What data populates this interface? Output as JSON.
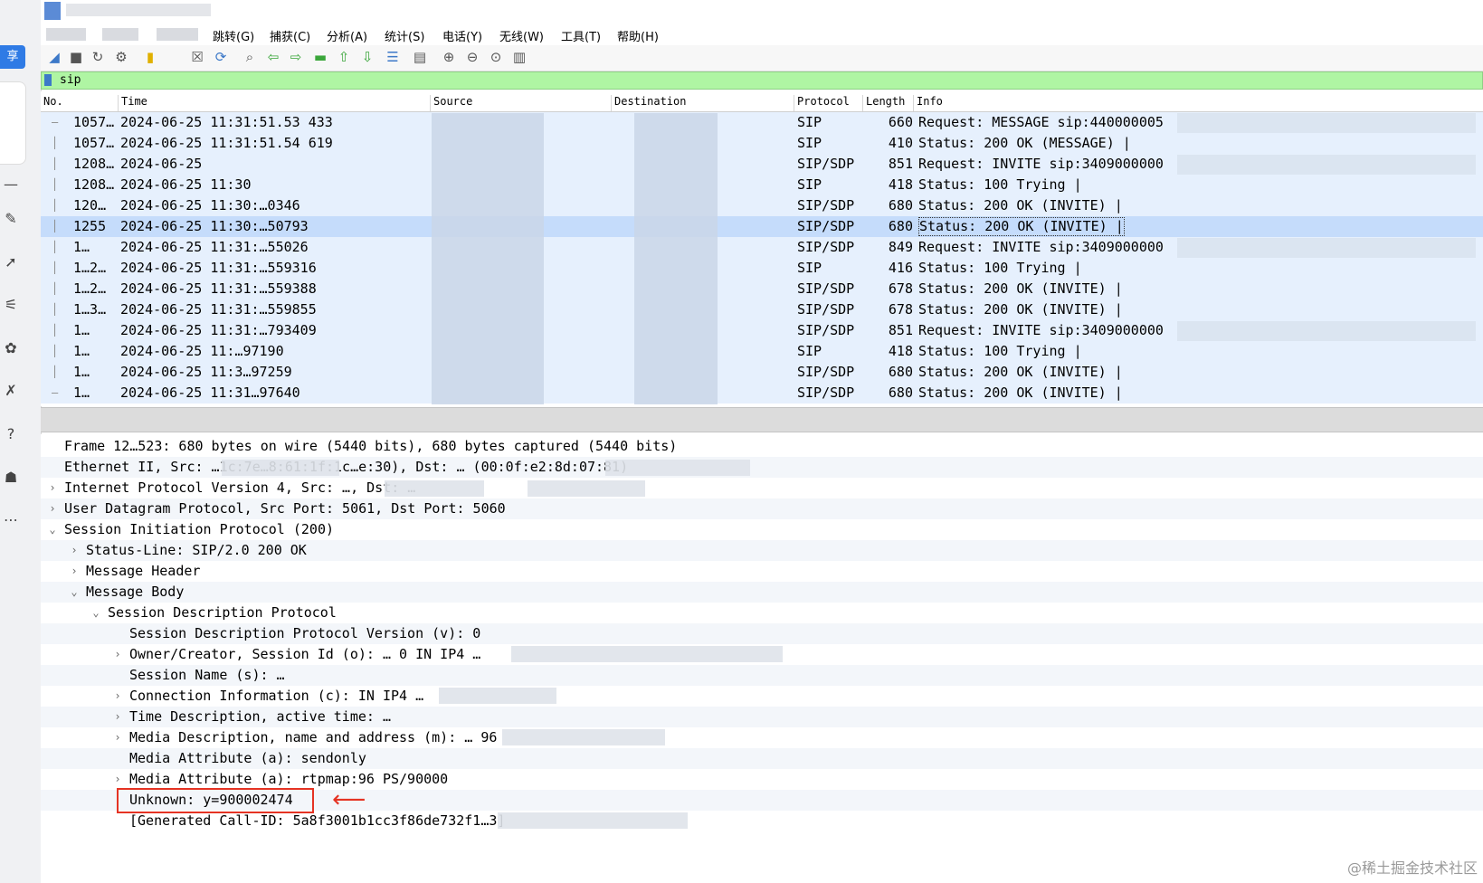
{
  "menubar": {
    "items": [
      "跳转(G)",
      "捕获(C)",
      "分析(A)",
      "统计(S)",
      "电话(Y)",
      "无线(W)",
      "工具(T)",
      "帮助(H)"
    ]
  },
  "sidebar": {
    "share_label": "享"
  },
  "filter": {
    "value": "sip"
  },
  "packet_list": {
    "headers": [
      "No.",
      "Time",
      "Source",
      "Destination",
      "Protocol",
      "Length",
      "Info"
    ],
    "rows": [
      {
        "no": "1057…",
        "time": "2024-06-25 11:31:51.53 433",
        "protocol": "SIP",
        "length": "660",
        "info": "Request: MESSAGE sip:440000005"
      },
      {
        "no": "1057…",
        "time": "2024-06-25 11:31:51.54 619",
        "protocol": "SIP",
        "length": "410",
        "info": "Status: 200 OK (MESSAGE) |"
      },
      {
        "no": "1208…",
        "time": "2024-06-25",
        "protocol": "SIP/SDP",
        "length": "851",
        "info": "Request: INVITE sip:3409000000"
      },
      {
        "no": "1208…",
        "time": "2024-06-25 11:30",
        "protocol": "SIP",
        "length": "418",
        "info": "Status: 100 Trying |"
      },
      {
        "no": "120…",
        "time": "2024-06-25 11:30:…0346",
        "protocol": "SIP/SDP",
        "length": "680",
        "info": "Status: 200 OK (INVITE) |"
      },
      {
        "no": "1255",
        "time": "2024-06-25 11:30:…50793",
        "protocol": "SIP/SDP",
        "length": "680",
        "info": "Status: 200 OK (INVITE) |",
        "selected": true
      },
      {
        "no": "1…",
        "time": "2024-06-25 11:31:…55026",
        "protocol": "SIP/SDP",
        "length": "849",
        "info": "Request: INVITE sip:3409000000"
      },
      {
        "no": "1…2…",
        "time": "2024-06-25 11:31:…559316",
        "protocol": "SIP",
        "length": "416",
        "info": "Status: 100 Trying |"
      },
      {
        "no": "1…2…",
        "time": "2024-06-25 11:31:…559388",
        "protocol": "SIP/SDP",
        "length": "678",
        "info": "Status: 200 OK (INVITE) |"
      },
      {
        "no": "1…3…",
        "time": "2024-06-25 11:31:…559855",
        "protocol": "SIP/SDP",
        "length": "678",
        "info": "Status: 200 OK (INVITE) |"
      },
      {
        "no": "1…",
        "time": "2024-06-25 11:31:…793409",
        "protocol": "SIP/SDP",
        "length": "851",
        "info": "Request: INVITE sip:3409000000"
      },
      {
        "no": "1…",
        "time": "2024-06-25 11:…97190",
        "protocol": "SIP",
        "length": "418",
        "info": "Status: 100 Trying |"
      },
      {
        "no": "1…",
        "time": "2024-06-25 11:3…97259",
        "protocol": "SIP/SDP",
        "length": "680",
        "info": "Status: 200 OK (INVITE) |"
      },
      {
        "no": "1…",
        "time": "2024-06-25 11:31…97640",
        "protocol": "SIP/SDP",
        "length": "680",
        "info": "Status: 200 OK (INVITE) |"
      }
    ]
  },
  "details": [
    {
      "text": "Frame 12…523: 680 bytes on wire (5440 bits), 680 bytes captured (5440 bits)",
      "expander": "",
      "indent": 0
    },
    {
      "text": "Ethernet II, Src: …1c:7e…8:61:1f:1c…e:30), Dst: … (00:0f:e2:8d:07:81)",
      "expander": "",
      "indent": 0
    },
    {
      "text": "Internet Protocol Version 4, Src: …, Dst: …",
      "expander": ">",
      "indent": 0
    },
    {
      "text": "User Datagram Protocol, Src Port: 5061, Dst Port: 5060",
      "expander": ">",
      "indent": 0
    },
    {
      "text": "Session Initiation Protocol (200)",
      "expander": "v",
      "indent": 0
    },
    {
      "text": "Status-Line: SIP/2.0 200 OK",
      "expander": ">",
      "indent": 1
    },
    {
      "text": "Message Header",
      "expander": ">",
      "indent": 1
    },
    {
      "text": "Message Body",
      "expander": "v",
      "indent": 1
    },
    {
      "text": "Session Description Protocol",
      "expander": "v",
      "indent": 2
    },
    {
      "text": "Session Description Protocol Version (v): 0",
      "expander": "",
      "indent": 3
    },
    {
      "text": "Owner/Creator, Session Id (o): … 0 IN IP4 …",
      "expander": ">",
      "indent": 3
    },
    {
      "text": "Session Name (s): …",
      "expander": "",
      "indent": 3
    },
    {
      "text": "Connection Information (c): IN IP4 …",
      "expander": ">",
      "indent": 3
    },
    {
      "text": "Time Description, active time: …",
      "expander": ">",
      "indent": 3
    },
    {
      "text": "Media Description, name and address (m): … 96",
      "expander": ">",
      "indent": 3
    },
    {
      "text": "Media Attribute (a): sendonly",
      "expander": "",
      "indent": 3
    },
    {
      "text": "Media Attribute (a): rtpmap:96 PS/90000",
      "expander": ">",
      "indent": 3
    },
    {
      "text": "Unknown: y=900002474",
      "expander": "",
      "indent": 3,
      "highlight": true
    },
    {
      "text": "[Generated Call-ID: 5a8f3001b1cc3f86de732f1…3]",
      "expander": "",
      "indent": 3
    }
  ],
  "watermark": "@稀土掘金技术社区",
  "colors": {
    "filter_bg": "#aff5a3",
    "row_bg": "#e6f0fd",
    "selected_row_bg": "#c5dcfb",
    "highlight": "#e53323"
  }
}
